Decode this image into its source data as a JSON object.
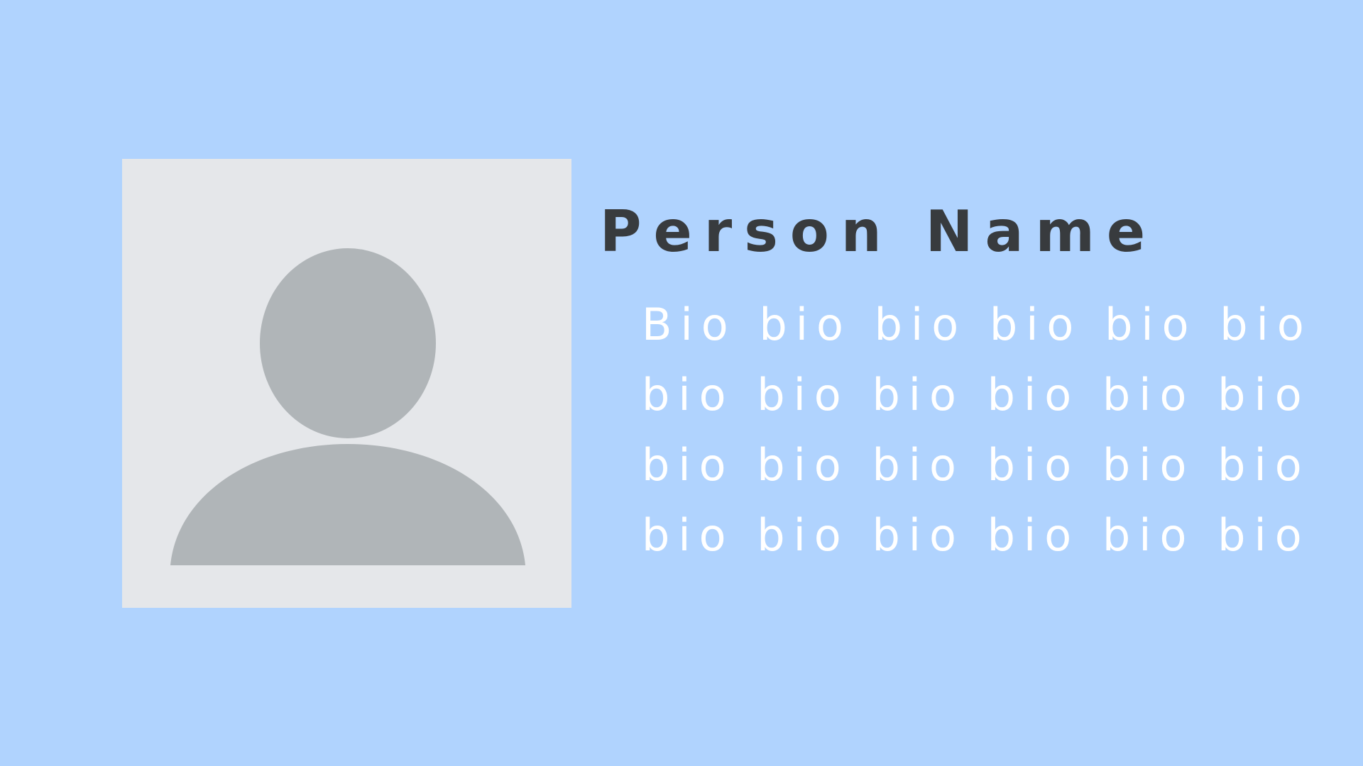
{
  "person": {
    "name": "Person Name"
  },
  "bio": {
    "lines": [
      "Bio bio bio bio bio bio",
      "bio bio bio bio bio bio",
      "bio bio bio bio bio bio",
      "bio bio bio bio bio bio"
    ]
  },
  "colors": {
    "background": "#b0d3fe",
    "avatar_frame": "#e5e7ea",
    "avatar_silhouette": "#b0b5b8",
    "name_text": "#383b3e",
    "bio_text": "#ffffff"
  },
  "icons": {
    "avatar": "person-silhouette-icon"
  }
}
